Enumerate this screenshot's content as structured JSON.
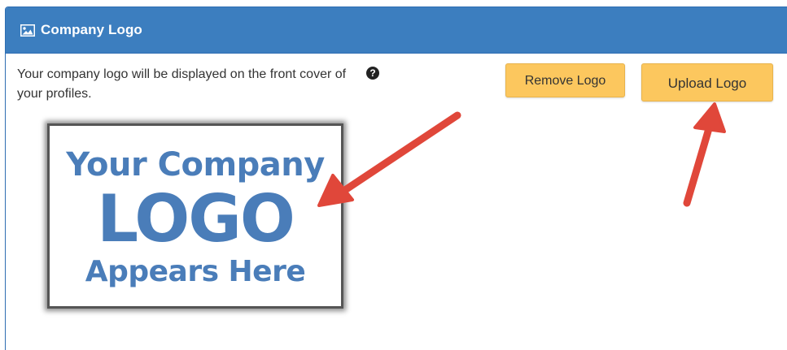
{
  "panel": {
    "title": "Company Logo",
    "header_icon": "image-icon"
  },
  "description": "Your company logo will be displayed on the front cover of your profiles.",
  "help": {
    "icon": "question-circle-icon",
    "glyph": "?"
  },
  "buttons": {
    "remove_label": "Remove Logo",
    "upload_label": "Upload Logo"
  },
  "logo_preview": {
    "line1": "Your Company",
    "line2": "LOGO",
    "line3": "Appears Here"
  },
  "colors": {
    "header_bg": "#3c7ebf",
    "button_bg": "#fcc75e",
    "logo_text": "#4a7db9",
    "arrow": "#e0473a"
  }
}
